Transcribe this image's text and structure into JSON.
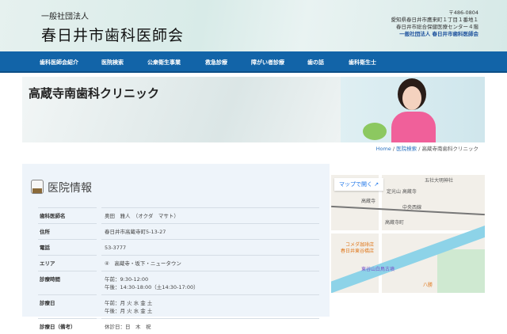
{
  "header": {
    "org_small": "一般社団法人",
    "org_name": "春日井市歯科医師会",
    "address": [
      "〒486-0804",
      "愛知県春日井市鷹来町１丁目１番地１",
      "春日井市総合保健医療センター４階"
    ],
    "address_org": "一般社団法人 春日井市歯科医師会"
  },
  "nav": [
    "歯科医師会紹介",
    "医院検索",
    "公衆衛生事業",
    "救急診療",
    "障がい者診療",
    "歯の話",
    "歯科衛生士"
  ],
  "banner": {
    "title": "高蔵寺南歯科クリニック"
  },
  "breadcrumb": {
    "home": "Home",
    "sep": "/",
    "search": "医院検索",
    "current": "高蔵寺南歯科クリニック"
  },
  "clinic": {
    "heading": "医院情報",
    "rows": [
      {
        "label": "歯科医師名",
        "lines": [
          "奥田　雅人　（オクダ　マサト）"
        ]
      },
      {
        "label": "住所",
        "lines": [
          "春日井市高蔵寺町5-13-27"
        ]
      },
      {
        "label": "電話",
        "lines": [
          "53-3777"
        ]
      },
      {
        "label": "エリア",
        "lines": [
          "④　高蔵寺・坂下・ニュータウン"
        ]
      },
      {
        "label": "診療時間",
        "lines": [
          "午前：9:30-12:00",
          "午後：14:30-18:00（土14:30-17:00）"
        ]
      },
      {
        "label": "診療日",
        "lines": [
          "午前：月 火 水 金 土",
          "午後：月 火 水 金 土"
        ]
      },
      {
        "label": "診療日（備考）",
        "lines": [
          "休診日：日　木　祝"
        ]
      }
    ]
  },
  "map": {
    "open_label": "マップで開く",
    "labels": [
      "五社大明神社",
      "高蔵寺",
      "中央西線",
      "高蔵寺町",
      "コメダ珈琲店",
      "春日井東谷橋店",
      "東谷山白鳥古墳",
      "八勝",
      "定光山 高蔵寺"
    ]
  }
}
